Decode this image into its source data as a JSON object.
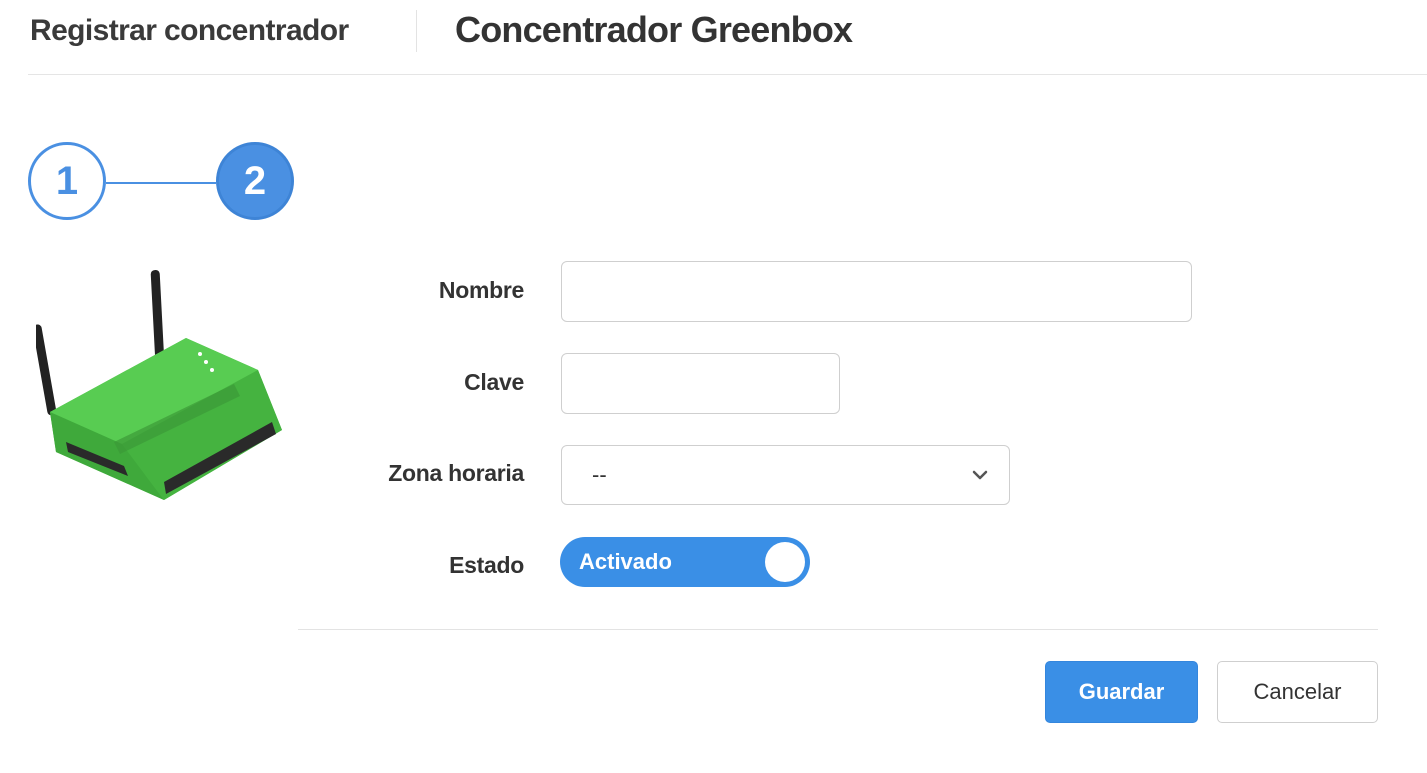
{
  "header": {
    "breadcrumb": "Registrar concentrador",
    "title": "Concentrador Greenbox"
  },
  "stepper": {
    "steps": [
      "1",
      "2"
    ],
    "active_step": 2
  },
  "form": {
    "nombre": {
      "label": "Nombre",
      "value": ""
    },
    "clave": {
      "label": "Clave",
      "value": ""
    },
    "zona_horaria": {
      "label": "Zona horaria",
      "selected": "--"
    },
    "estado": {
      "label": "Estado",
      "toggle_label": "Activado",
      "on": true
    }
  },
  "actions": {
    "save_label": "Guardar",
    "cancel_label": "Cancelar"
  },
  "colors": {
    "accent": "#4a90e2",
    "primary_button": "#3a8fe6",
    "device_green": "#4fc24a"
  },
  "icons": {
    "select_chevron": "chevron-down-icon",
    "device_image": "router-device-image"
  }
}
